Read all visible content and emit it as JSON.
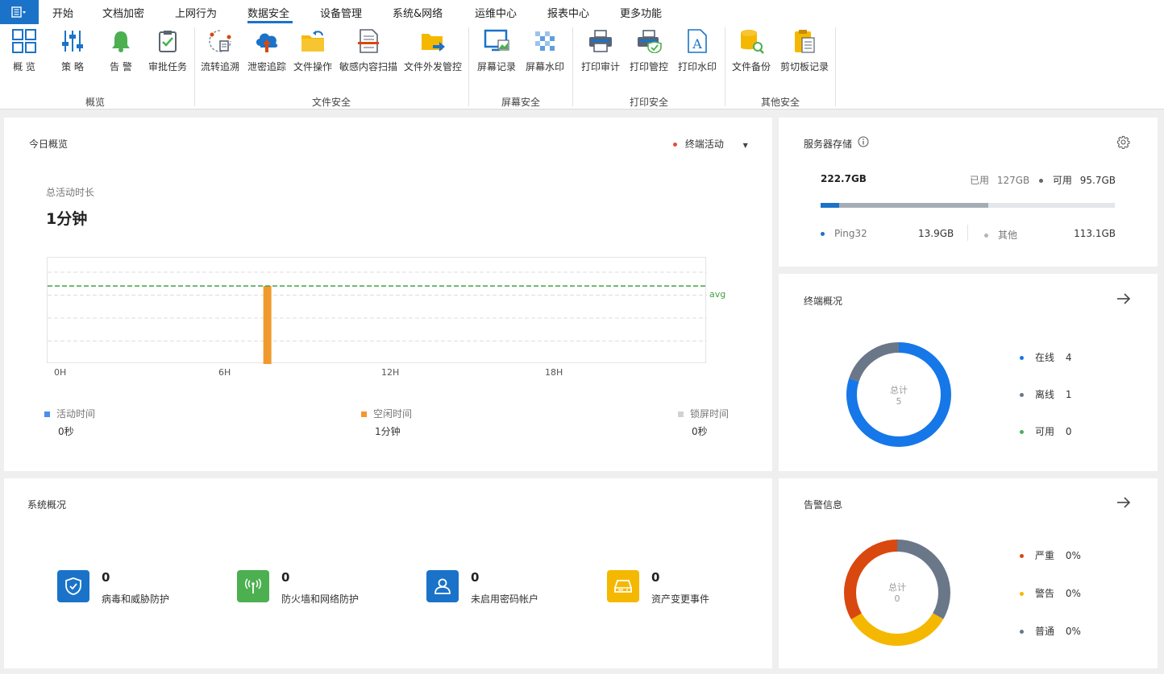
{
  "menubar": {
    "tabs": [
      "开始",
      "文档加密",
      "上网行为",
      "数据安全",
      "设备管理",
      "系统&网络",
      "运维中心",
      "报表中心",
      "更多功能"
    ],
    "active_tab": "数据安全"
  },
  "ribbon": {
    "buttons": [
      "概 览",
      "策 略",
      "告 警",
      "审批任务",
      "流转追溯",
      "泄密追踪",
      "文件操作",
      "敏感内容扫描",
      "文件外发管控",
      "屏幕记录",
      "屏幕水印",
      "打印审计",
      "打印管控",
      "打印水印",
      "文件备份",
      "剪切板记录"
    ],
    "groups": [
      "概览",
      "文件安全",
      "屏幕安全",
      "打印安全",
      "其他安全"
    ]
  },
  "today": {
    "title": "今日概览",
    "filter_label": "终端活动",
    "metric_label": "总活动时长",
    "metric_value": "1分钟",
    "avg_label": "avg",
    "legend": [
      {
        "label": "活动时间",
        "value": "0秒",
        "color": "#4b8df0"
      },
      {
        "label": "空闲时间",
        "value": "1分钟",
        "color": "#f09a2e"
      },
      {
        "label": "锁屏时间",
        "value": "0秒",
        "color": "#d2d2d2"
      }
    ]
  },
  "chart_data": {
    "type": "bar",
    "x_ticks": [
      "0H",
      "6H",
      "12H",
      "18H"
    ],
    "x_range_hours": [
      0,
      24
    ],
    "bars": [
      {
        "hour": 8,
        "value": 0.85,
        "series": "空闲时间",
        "color": "#f09a2e"
      }
    ],
    "avg_line": 0.85,
    "ylim": [
      0,
      1
    ],
    "grid": true
  },
  "storage": {
    "title": "服务器存储",
    "total": "222.7GB",
    "used_label": "已用",
    "used": "127GB",
    "free_label": "可用",
    "free": "95.7GB",
    "used_fraction": 0.57,
    "ping_fraction": 0.062,
    "items": [
      {
        "label": "Ping32",
        "value": "13.9GB",
        "color": "#1a73c8"
      },
      {
        "label": "其他",
        "value": "113.1GB",
        "color": "#b0b6bf"
      }
    ]
  },
  "terminals": {
    "title": "终端概况",
    "center_label": "总计",
    "center_value": "5",
    "items": [
      {
        "label": "在线",
        "value": "4",
        "color": "#1677e8"
      },
      {
        "label": "离线",
        "value": "1",
        "color": "#6a7789"
      },
      {
        "label": "可用",
        "value": "0",
        "color": "#4caf50"
      }
    ],
    "segments": [
      {
        "name": "在线",
        "fraction": 0.8,
        "color": "#1677e8"
      },
      {
        "name": "离线",
        "fraction": 0.2,
        "color": "#6a7789"
      }
    ]
  },
  "system": {
    "title": "系统概况",
    "stats": [
      {
        "value": "0",
        "label": "病毒和威胁防护",
        "icon": "shield-icon",
        "color": "#1a73c8"
      },
      {
        "value": "0",
        "label": "防火墙和网络防护",
        "icon": "wifi-icon",
        "color": "#4caf50"
      },
      {
        "value": "0",
        "label": "未启用密码帐户",
        "icon": "user-icon",
        "color": "#1a73c8"
      },
      {
        "value": "0",
        "label": "资产变更事件",
        "icon": "hdd-icon",
        "color": "#f5b800"
      }
    ]
  },
  "alerts": {
    "title": "告警信息",
    "center_label": "总计",
    "center_value": "0",
    "items": [
      {
        "label": "严重",
        "value": "0%",
        "color": "#d9480f"
      },
      {
        "label": "警告",
        "value": "0%",
        "color": "#f5b800"
      },
      {
        "label": "普通",
        "value": "0%",
        "color": "#6a7789"
      }
    ],
    "segments": [
      {
        "name": "普通",
        "fraction": 0.333,
        "color": "#6a7789"
      },
      {
        "name": "警告",
        "fraction": 0.333,
        "color": "#f5b800"
      },
      {
        "name": "严重",
        "fraction": 0.334,
        "color": "#d9480f"
      }
    ]
  }
}
